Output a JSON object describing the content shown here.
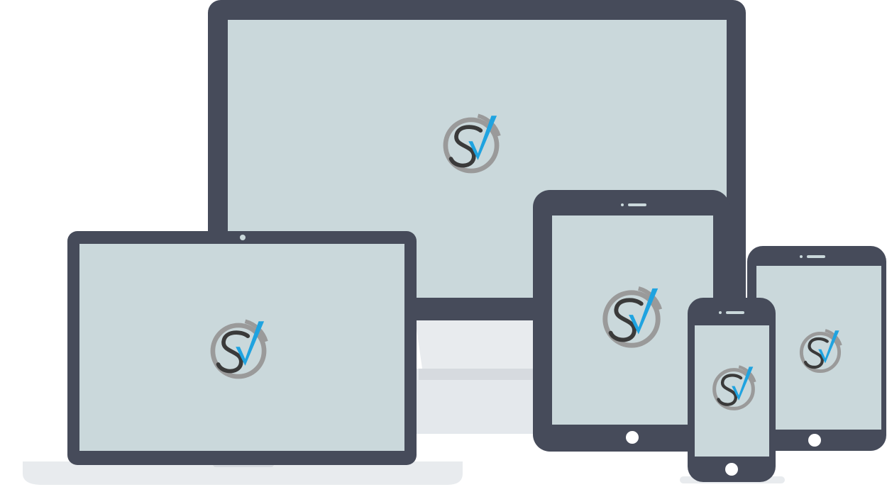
{
  "scene": {
    "description_label": "",
    "devices": [
      {
        "id": "desktop-monitor",
        "logo_text": "SV"
      },
      {
        "id": "laptop",
        "logo_text": "SV"
      },
      {
        "id": "tablet-large",
        "logo_text": "SV"
      },
      {
        "id": "smartphone",
        "logo_text": "SV"
      },
      {
        "id": "tablet-small",
        "logo_text": "SV"
      }
    ]
  },
  "colors": {
    "background": "#ffffff",
    "device_frame": "#464b5a",
    "screen": "#cad8db",
    "stand_light": "#e8ebee",
    "stand_shadow": "#d6dadf",
    "logo_ring": "#9a9a9a",
    "logo_s": "#3a3a3a",
    "logo_check": "#1fa3e0",
    "button_white": "#ffffff"
  },
  "icons": [
    "sv-check-logo",
    "home-button",
    "camera-dot",
    "speaker-slot"
  ]
}
